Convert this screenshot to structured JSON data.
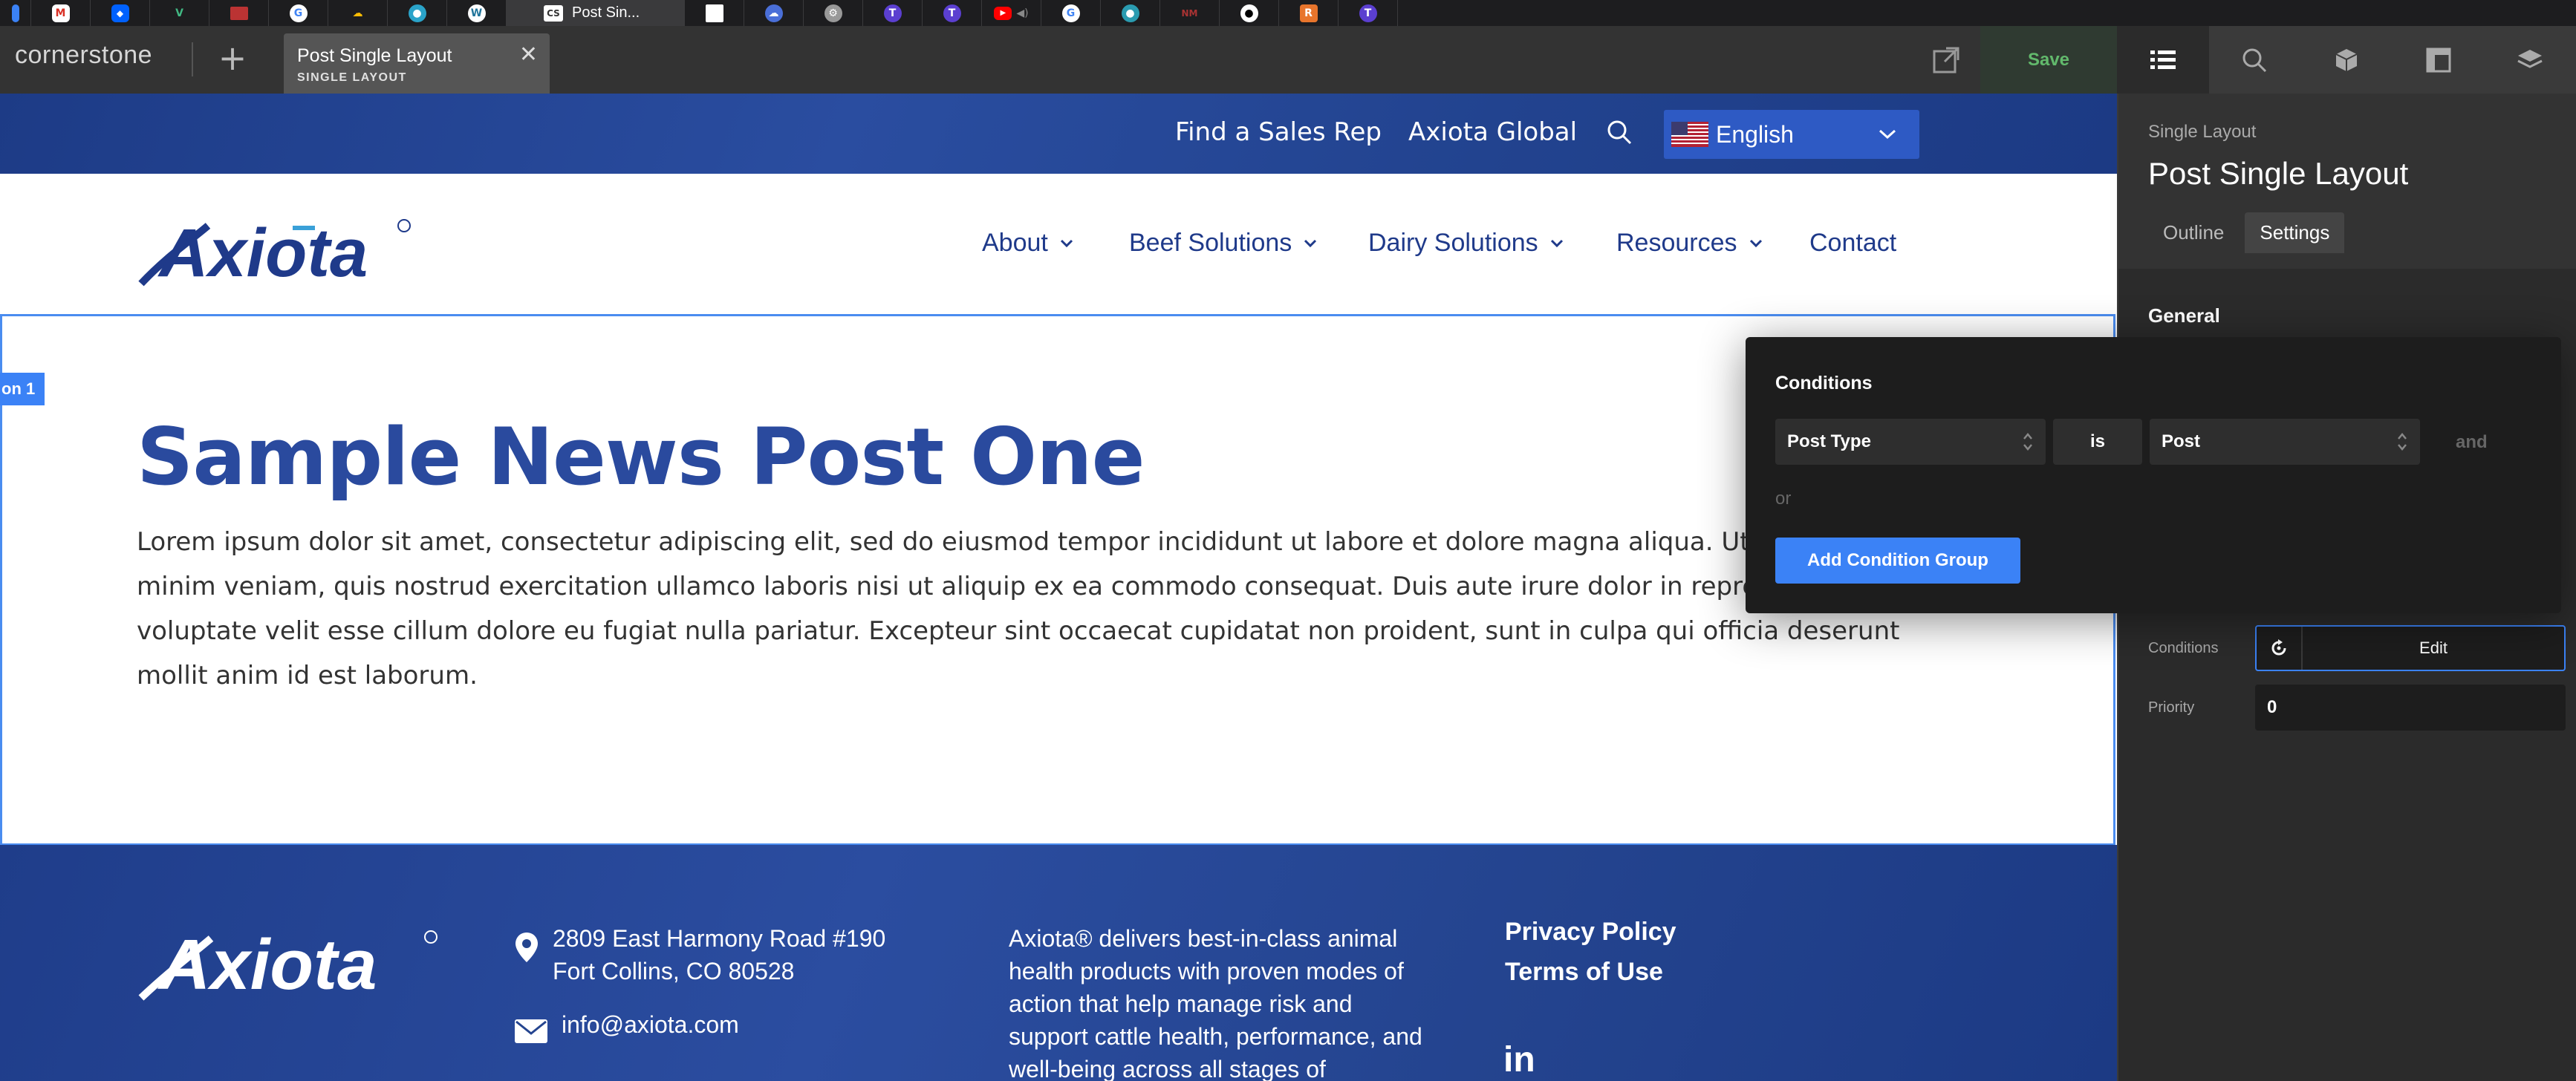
{
  "browser": {
    "active_tab_label": "Post Sin..."
  },
  "cornerstone": {
    "logo": "cornerstone",
    "doc_tab": {
      "title": "Post Single Layout",
      "subtitle": "SINGLE LAYOUT"
    },
    "save_label": "Save"
  },
  "right_panel": {
    "kicker": "Single Layout",
    "title": "Post Single Layout",
    "tabs": [
      {
        "label": "Outline"
      },
      {
        "label": "Settings"
      }
    ],
    "section": "General",
    "conditions_label": "Conditions",
    "conditions_button": "Edit",
    "priority_label": "Priority",
    "priority_value": "0"
  },
  "conditions_popover": {
    "title": "Conditions",
    "field": "Post Type",
    "operator": "is",
    "value": "Post",
    "and_label": "and",
    "or_label": "or",
    "add_group": "Add Condition Group"
  },
  "site": {
    "utility": {
      "links": [
        "Find a Sales Rep",
        "Axiota Global"
      ],
      "language": "English"
    },
    "logo_text": "Axiota",
    "nav": [
      {
        "label": "About"
      },
      {
        "label": "Beef Solutions"
      },
      {
        "label": "Dairy Solutions"
      },
      {
        "label": "Resources"
      },
      {
        "label": "Contact"
      }
    ],
    "section_tag": "on 1",
    "post": {
      "title": "Sample News Post One",
      "body": "Lorem ipsum dolor sit amet, consectetur adipiscing elit, sed do eiusmod tempor incididunt ut labore et dolore magna aliqua. Ut enim ad minim veniam, quis nostrud exercitation ullamco laboris nisi ut aliquip ex ea commodo consequat. Duis aute irure dolor in reprehenderit in voluptate velit esse cillum dolore eu fugiat nulla pariatur. Excepteur sint occaecat cupidatat non proident, sunt in culpa qui officia deserunt mollit anim id est laborum."
    },
    "footer": {
      "address_line1": "2809 East Harmony Road #190",
      "address_line2": "Fort Collins, CO 80528",
      "email": "info@axiota.com",
      "description": "Axiota® delivers best-in-class animal health products with proven modes of action that help manage risk and support cattle health, performance, and well-being across all stages of",
      "links": [
        "Privacy Policy",
        "Terms of Use"
      ],
      "social": "in"
    }
  },
  "colors": {
    "accent": "#3b82f6",
    "brand_blue": "#2a4a9e",
    "nav_text": "#1f3a8a",
    "save_green": "#62b96c"
  }
}
